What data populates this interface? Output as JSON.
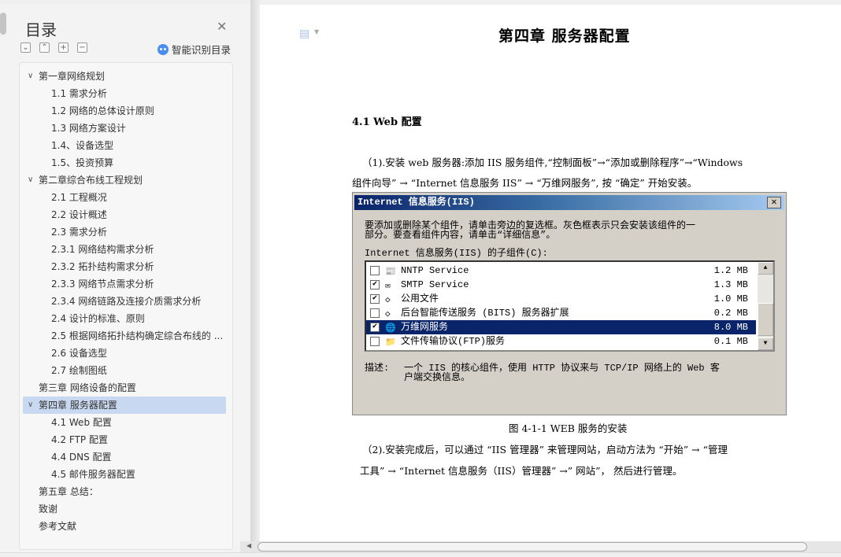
{
  "sidebar": {
    "title": "目录",
    "smart_toc_label": "智能识别目录",
    "toolbar": [
      "expand",
      "collapse",
      "add",
      "remove"
    ],
    "items": [
      {
        "label": "第一章网络规划",
        "level": 1,
        "expanded": true
      },
      {
        "label": "1.1 需求分析",
        "level": 2
      },
      {
        "label": "1.2 网络的总体设计原则",
        "level": 2
      },
      {
        "label": "1.3 网络方案设计",
        "level": 2
      },
      {
        "label": "1.4、设备选型",
        "level": 2
      },
      {
        "label": "1.5、投资预算",
        "level": 2
      },
      {
        "label": "第二章综合布线工程规划",
        "level": 1,
        "expanded": true
      },
      {
        "label": "2.1 工程概况",
        "level": 2
      },
      {
        "label": "2.2 设计概述",
        "level": 2
      },
      {
        "label": "2.3 需求分析",
        "level": 2
      },
      {
        "label": "2.3.1    网络结构需求分析",
        "level": 2
      },
      {
        "label": "2.3.2  拓扑结构需求分析",
        "level": 2
      },
      {
        "label": "2.3.3    网络节点需求分析",
        "level": 2
      },
      {
        "label": "2.3.4    网络链路及连接介质需求分析",
        "level": 2
      },
      {
        "label": "2.4 设计的标准、原则",
        "level": 2
      },
      {
        "label": "2.5 根据网络拓扑结构确定综合布线的 ...",
        "level": 2
      },
      {
        "label": "2.6  设备选型",
        "level": 2
      },
      {
        "label": "2.7  绘制图纸",
        "level": 2
      },
      {
        "label": "第三章  网络设备的配置",
        "level": 1
      },
      {
        "label": "第四章  服务器配置",
        "level": 1,
        "expanded": true,
        "selected": true
      },
      {
        "label": "4.1 Web 配置",
        "level": 2
      },
      {
        "label": "4.2 FTP 配置",
        "level": 2
      },
      {
        "label": "4.4 DNS 配置",
        "level": 2
      },
      {
        "label": "4.5 邮件服务器配置",
        "level": 2
      },
      {
        "label": "第五章  总结：",
        "level": 1
      },
      {
        "label": "致谢",
        "level": 1
      },
      {
        "label": "参考文献",
        "level": 1
      }
    ]
  },
  "document": {
    "chapter_title": "第四章  服务器配置",
    "section_title": "4.1 Web 配置",
    "para1_line1": "（1).安装 web 服务器:添加 IIS 服务组件,“控制面板”→“添加或删除程序”→“Windows",
    "para1_line2": "组件向导” → “Internet 信息服务 IIS” → “万维网服务”, 按 “确定” 开始安装。",
    "caption": "图 4-1-1 WEB 服务的安装",
    "para2_line1": "（2).安装完成后，可以通过 “IIS 管理器” 来管理网站，启动方法为 “开始” → “管理",
    "para2_line2": "工具” → “Internet 信息服务（IIS）管理器”  →” 网站”，  然后进行管理。"
  },
  "dialog": {
    "title": "Internet 信息服务(IIS)",
    "close": "✕",
    "instr_line1": "要添加或删除某个组件，请单击旁边的复选框。灰色框表示只会安装该组件的一",
    "instr_line2": "部分。要查看组件内容，请单击“详细信息”。",
    "list_label": "Internet 信息服务(IIS) 的子组件(C):",
    "rows": [
      {
        "name": "NNTP Service",
        "size": "1.2 MB",
        "checked": false,
        "icon": "news-icon"
      },
      {
        "name": "SMTP Service",
        "size": "1.3 MB",
        "checked": true,
        "icon": "mail-icon"
      },
      {
        "name": "公用文件",
        "size": "1.0 MB",
        "checked": true,
        "icon": "diamond-icon"
      },
      {
        "name": "后台智能传送服务 (BITS) 服务器扩展",
        "size": "0.2 MB",
        "checked": false,
        "icon": "diamond-icon"
      },
      {
        "name": "万维网服务",
        "size": "8.0 MB",
        "checked": true,
        "selected": true,
        "icon": "globe-icon"
      },
      {
        "name": "文件传输协议(FTP)服务",
        "size": "0.1 MB",
        "checked": false,
        "icon": "folder-icon"
      }
    ],
    "desc_label": "描述:",
    "desc_line1": "一个 IIS 的核心组件，使用 HTTP 协议来与 TCP/IP 网络上的 Web 客",
    "desc_line2": "户端交换信息。"
  }
}
